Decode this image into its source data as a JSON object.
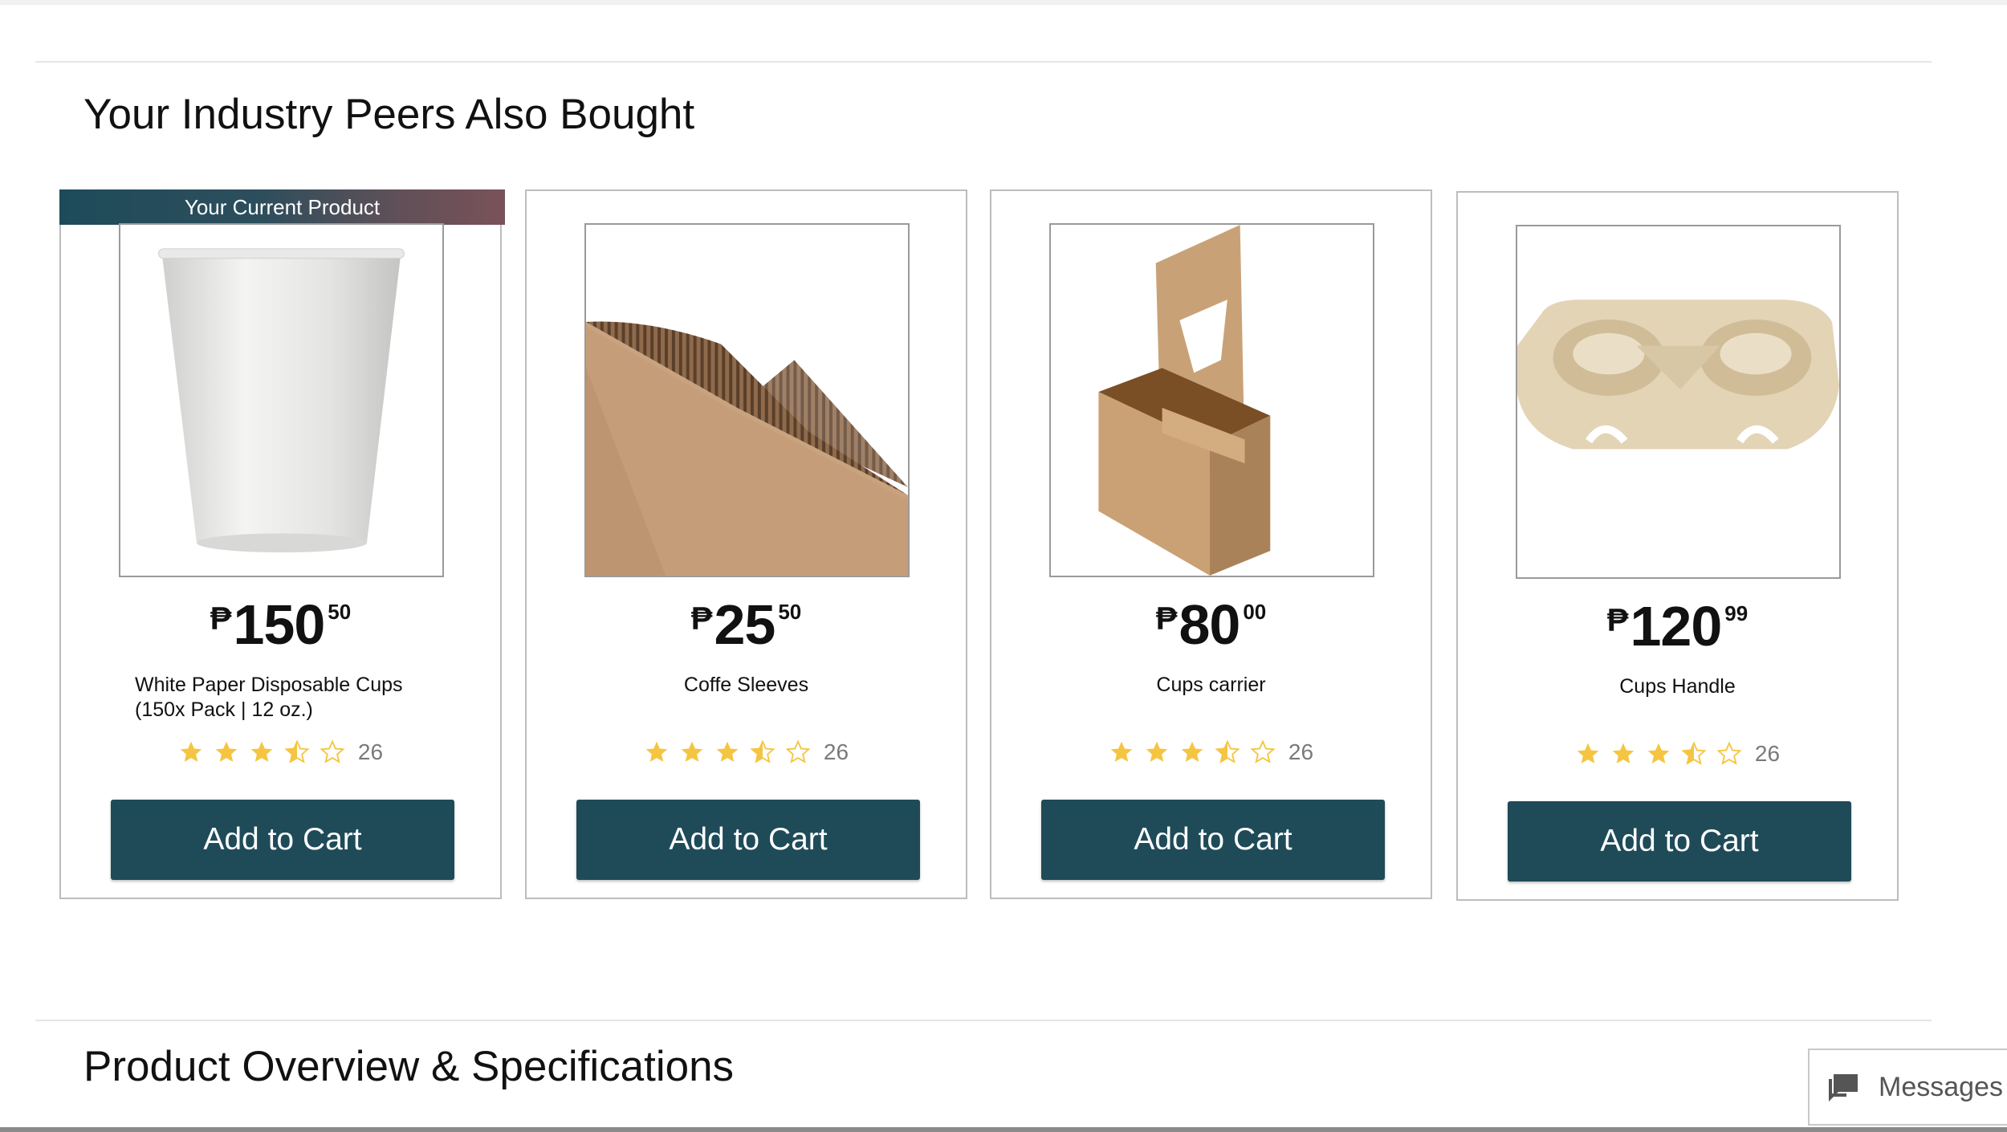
{
  "section_title": "Your Industry Peers Also Bought",
  "current_product_label": "Your Current Product",
  "products": [
    {
      "price_currency": "₱",
      "price_whole": "150",
      "price_cents": "50",
      "name_lines": [
        "White Paper Disposable Cups",
        "(150x Pack | 12 oz.)"
      ],
      "rating": 3.5,
      "review_count": "26",
      "add_to_cart_label": "Add to Cart",
      "image_icon": "white-paper-cup-image"
    },
    {
      "price_currency": "₱",
      "price_whole": "25",
      "price_cents": "50",
      "name": "Coffe Sleeves",
      "rating": 3.5,
      "review_count": "26",
      "add_to_cart_label": "Add to Cart",
      "image_icon": "corrugated-sleeve-image"
    },
    {
      "price_currency": "₱",
      "price_whole": "80",
      "price_cents": "00",
      "name": "Cups carrier",
      "rating": 3.5,
      "review_count": "26",
      "add_to_cart_label": "Add to Cart",
      "image_icon": "cup-carrier-image"
    },
    {
      "price_currency": "₱",
      "price_whole": "120",
      "price_cents": "99",
      "name": "Cups Handle",
      "rating": 3.5,
      "review_count": "26",
      "add_to_cart_label": "Add to Cart",
      "image_icon": "pulp-cup-tray-image"
    }
  ],
  "overview_title": "Product Overview & Specifications",
  "messages_label": "Messages",
  "colors": {
    "button": "#1f4b59",
    "star": "#f5c542",
    "banner_start": "#1e4b5a",
    "banner_end": "#7a5259"
  }
}
